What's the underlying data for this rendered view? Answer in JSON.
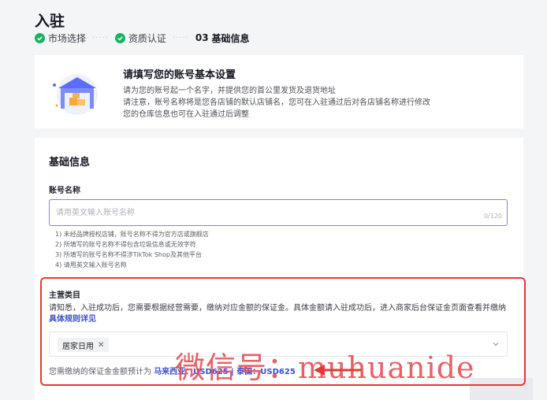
{
  "page": {
    "title": "入驻"
  },
  "steps": [
    {
      "label": "市场选择",
      "status": "done"
    },
    {
      "label": "资质认证",
      "status": "done"
    },
    {
      "number": "03",
      "label": "基础信息",
      "status": "current"
    }
  ],
  "intro": {
    "title": "请填写您的账号基本设置",
    "lines": [
      "请为您的账号起一个名字，并提供您的首公里发货及退货地址",
      "请注意，账号名称将是您各店铺的默认店铺名，您可在入驻通过后对各店铺名称进行修改",
      "您的仓库信息也可在入驻通过后调整"
    ]
  },
  "basic_info": {
    "title": "基础信息",
    "account_name": {
      "label": "账号名称",
      "placeholder": "请用英文输入账号名称",
      "value": "",
      "counter": "0/120"
    },
    "rules": [
      "1) 未经品牌授权店铺，账号名称不得为官方店或旗舰店",
      "2) 所填写的账号名称不得包含垃圾信息或无效字符",
      "3) 所填写的账号名称不得涉TikTok Shop及其他平台",
      "4) 请用英文输入账号名称"
    ],
    "main_category": {
      "label": "主营类目",
      "notice": "请知悉，入驻成功后，您需要根据经营需要，缴纳对应金额的保证金。具体金额请入驻成功后，进入商家后台保证金页面查看并缴纳",
      "link": "具体规则详见",
      "selected_tag": "居家日用",
      "deposit_prefix": "您需缴纳的保证金金额预计为",
      "deposit_amounts": "马来西亚：USD625 | 泰国：USD625"
    }
  },
  "annotation": {
    "watermark": "微信号：muhuanide",
    "color": "#e53935"
  },
  "colors": {
    "accent": "#3a4fcf",
    "success": "#16b364",
    "input_focus": "#8c7cf0"
  }
}
